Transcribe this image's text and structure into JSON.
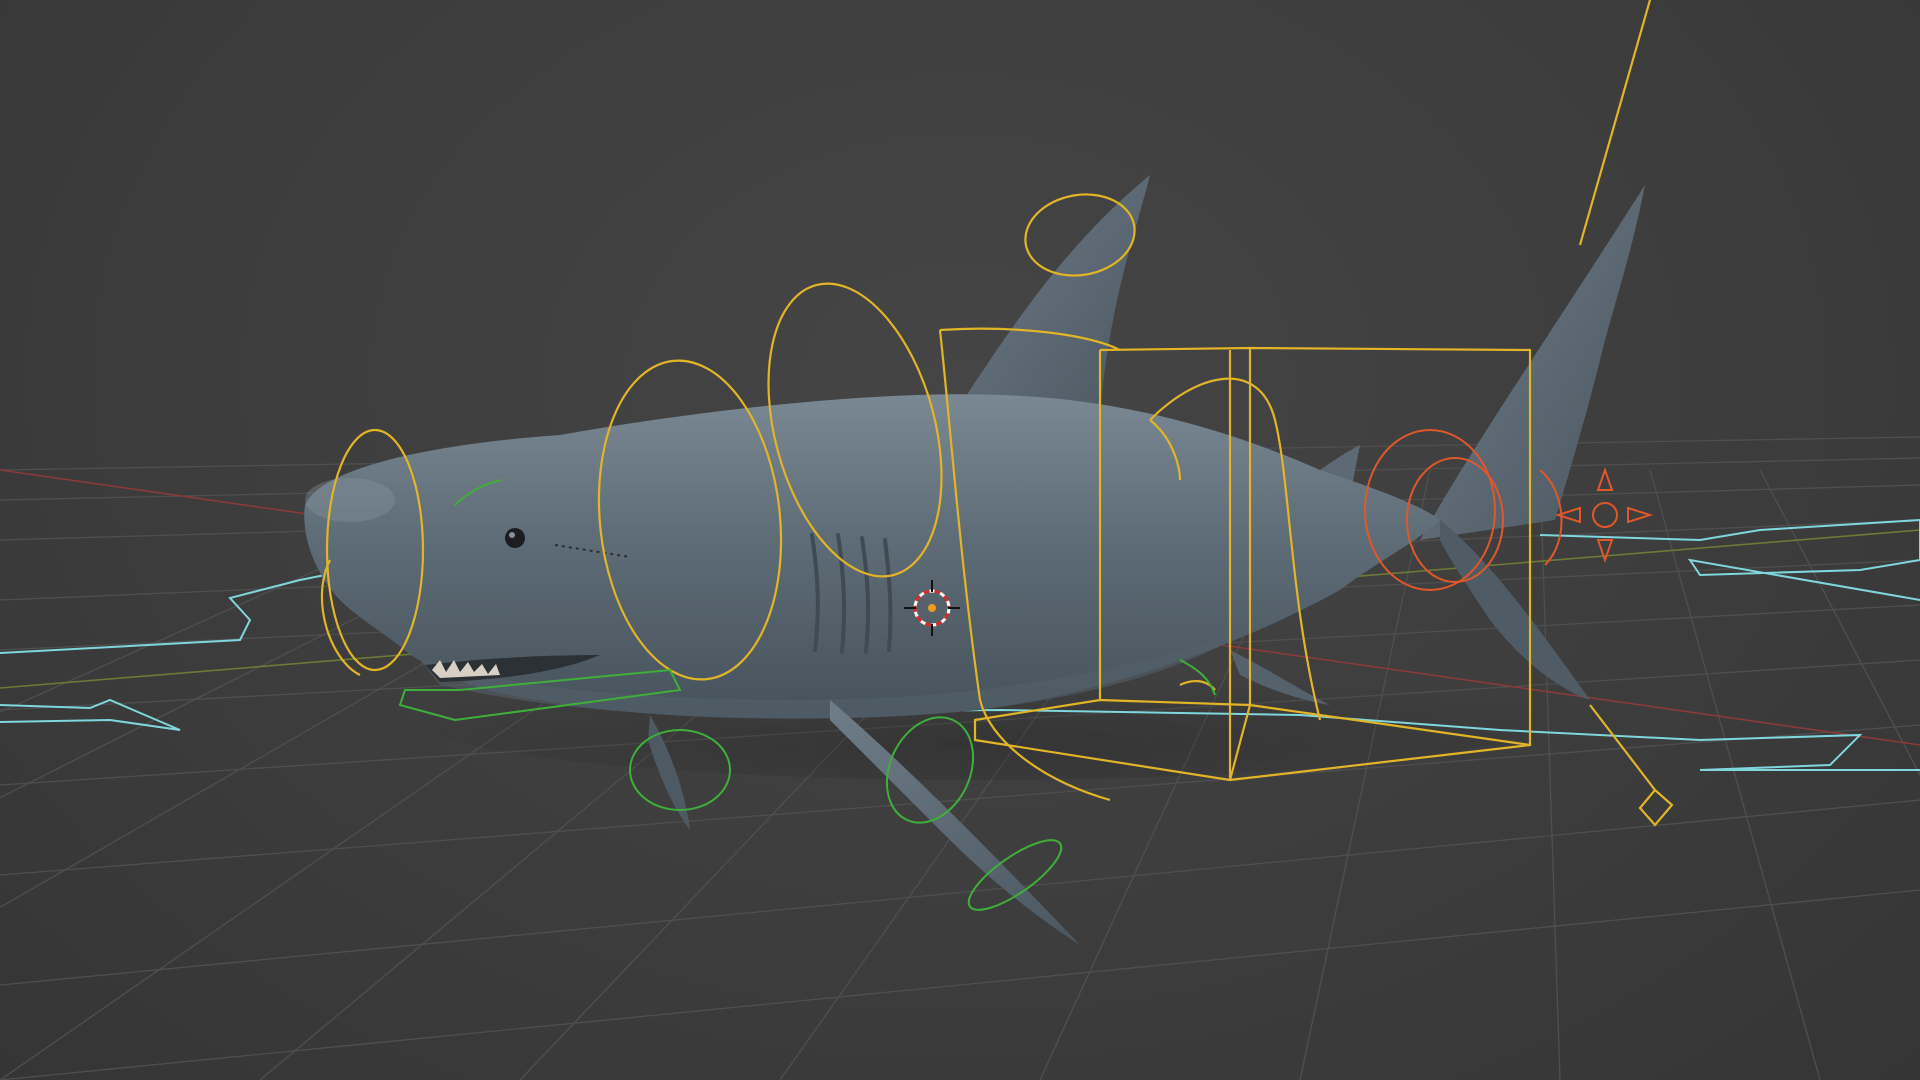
{
  "viewport": {
    "mode": "3D Viewport",
    "shading": "solid",
    "object": "shark",
    "overlays": [
      "grid-floor",
      "armature-controls",
      "motion-path",
      "3d-cursor"
    ]
  },
  "colors": {
    "background": "#3d3d3d",
    "grid": "#4c4c4c",
    "x_axis": "#8a3a3a",
    "y_axis": "#6b7a36",
    "mesh": "#5f6d78",
    "control_yellow": "#e2b428",
    "control_green": "#3fae3a",
    "control_orange": "#e0582a",
    "motion_path": "#7fd6dc"
  }
}
